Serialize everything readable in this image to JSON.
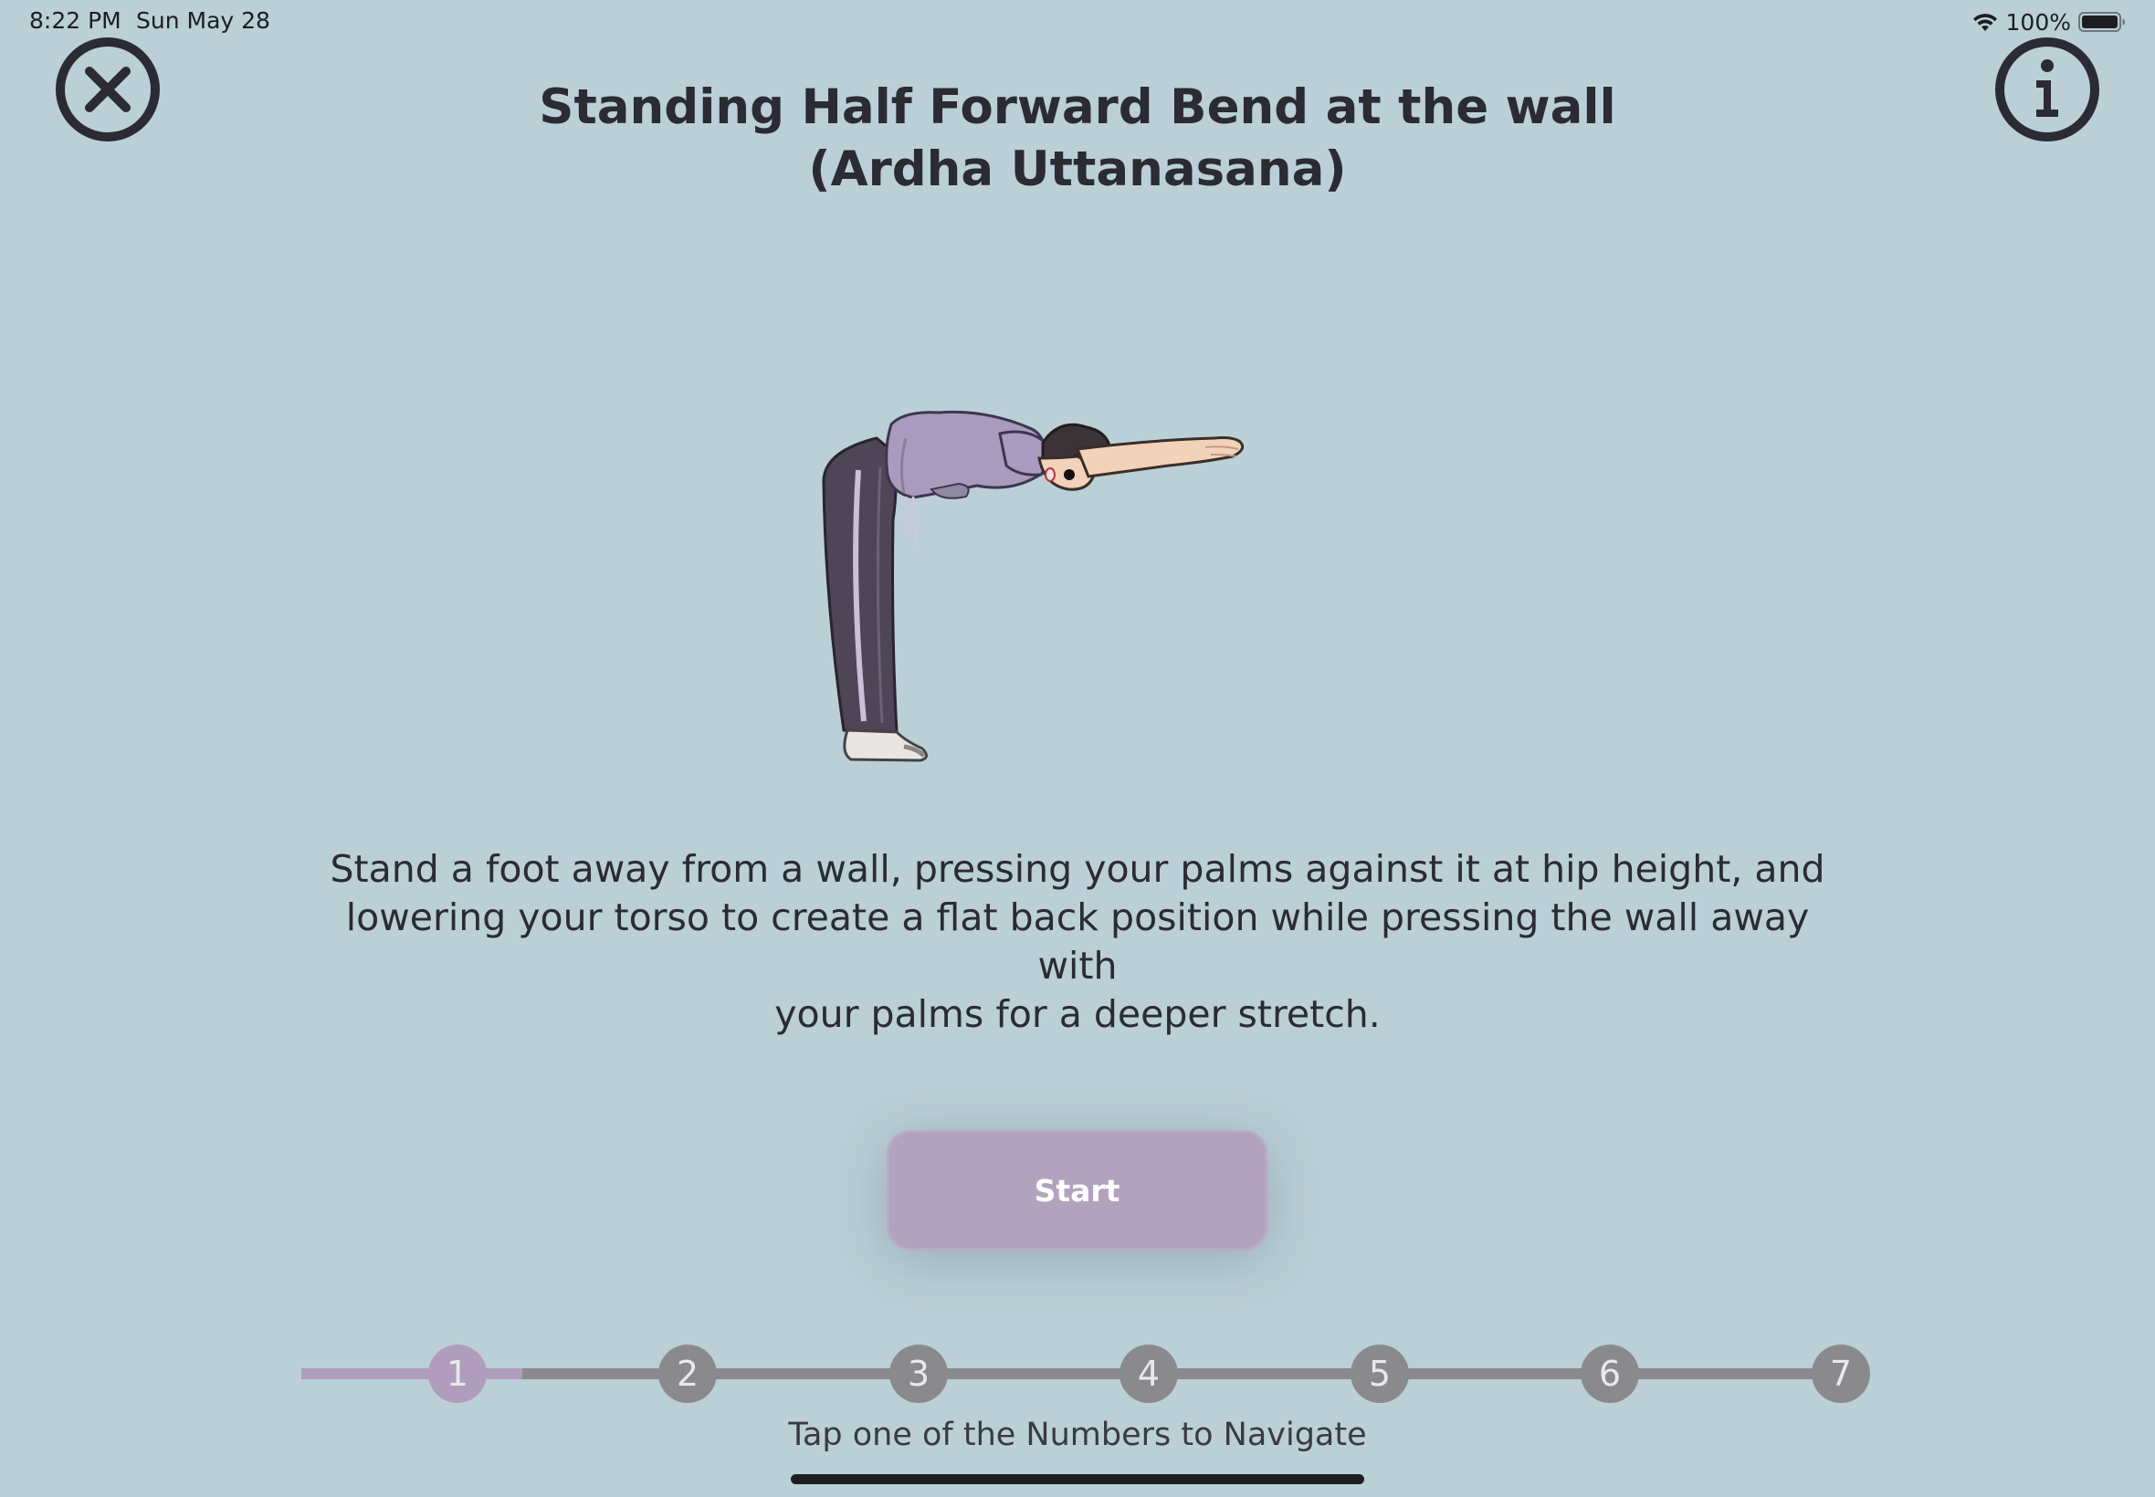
{
  "status_bar": {
    "time": "8:22 PM",
    "date": "Sun May 28",
    "battery": "100%",
    "icons": [
      "wifi-icon",
      "battery-icon"
    ]
  },
  "header": {
    "close_icon": "close-circle-icon",
    "info_icon": "info-circle-icon",
    "title_line1": "Standing Half Forward Bend at the wall",
    "title_line2": "(Ardha Uttanasana)"
  },
  "illustration": {
    "icon": "person-half-forward-bend-illustration"
  },
  "description": {
    "line1": "Stand a foot away from a wall, pressing your palms against it at hip height, and",
    "line2": "lowering your torso to create a flat back position while pressing the wall away with",
    "line3": "your palms for a deeper stretch."
  },
  "start_button": {
    "label": "Start"
  },
  "step_nav": {
    "current_step": 1,
    "total_steps": 7,
    "steps": [
      "1",
      "2",
      "3",
      "4",
      "5",
      "6",
      "7"
    ],
    "hint": "Tap one of the Numbers to Navigate"
  },
  "colors": {
    "background": "#bacfd6",
    "accent": "#b09dbd",
    "inactive": "#8a8a8c",
    "text": "#2b2b33"
  }
}
